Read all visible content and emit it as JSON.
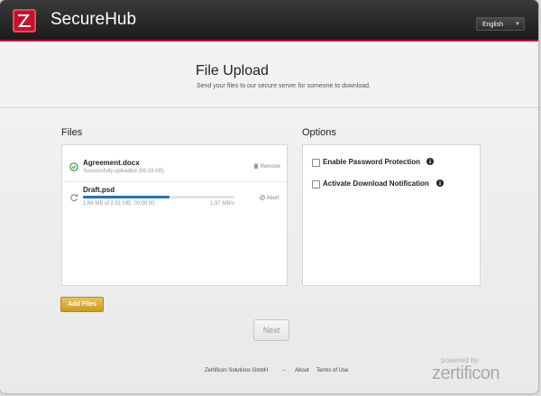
{
  "header": {
    "app_title": "SecureHub",
    "logo_letter": "Z",
    "language": {
      "selected": "English",
      "caret": "▼"
    }
  },
  "page": {
    "title": "File Upload",
    "subtitle": "Send your files to our secure server for someone to download."
  },
  "files_section": {
    "heading": "Files",
    "items": [
      {
        "name": "Agreement.docx",
        "status": "Successfully uploaded (66.03 KB)",
        "action": "Remove",
        "icon": "check-circle-icon",
        "state": "complete"
      },
      {
        "name": "Draft.psd",
        "status": "1.66 MB of 2.81 MB, 00:00:00",
        "speed": "1.97 MB/s",
        "action": "Abort",
        "icon": "refresh-icon",
        "state": "uploading",
        "progress": 0.57
      }
    ]
  },
  "options_section": {
    "heading": "Options",
    "items": [
      {
        "label": "Enable Password Protection",
        "checked": false
      },
      {
        "label": "Activate Download Notification",
        "checked": false
      }
    ]
  },
  "buttons": {
    "add_files": "Add Files",
    "next": "Next"
  },
  "footer": {
    "company": "Zertificon Solutions GmbH",
    "separator": "–",
    "about": "About",
    "terms": "Terms of Use",
    "powered_by": "powered by",
    "brand": "zertificon"
  },
  "colors": {
    "accent": "#c8102e",
    "progress": "#1f72b8",
    "success": "#3c9a3c",
    "button_gold": "#d9ab30"
  }
}
